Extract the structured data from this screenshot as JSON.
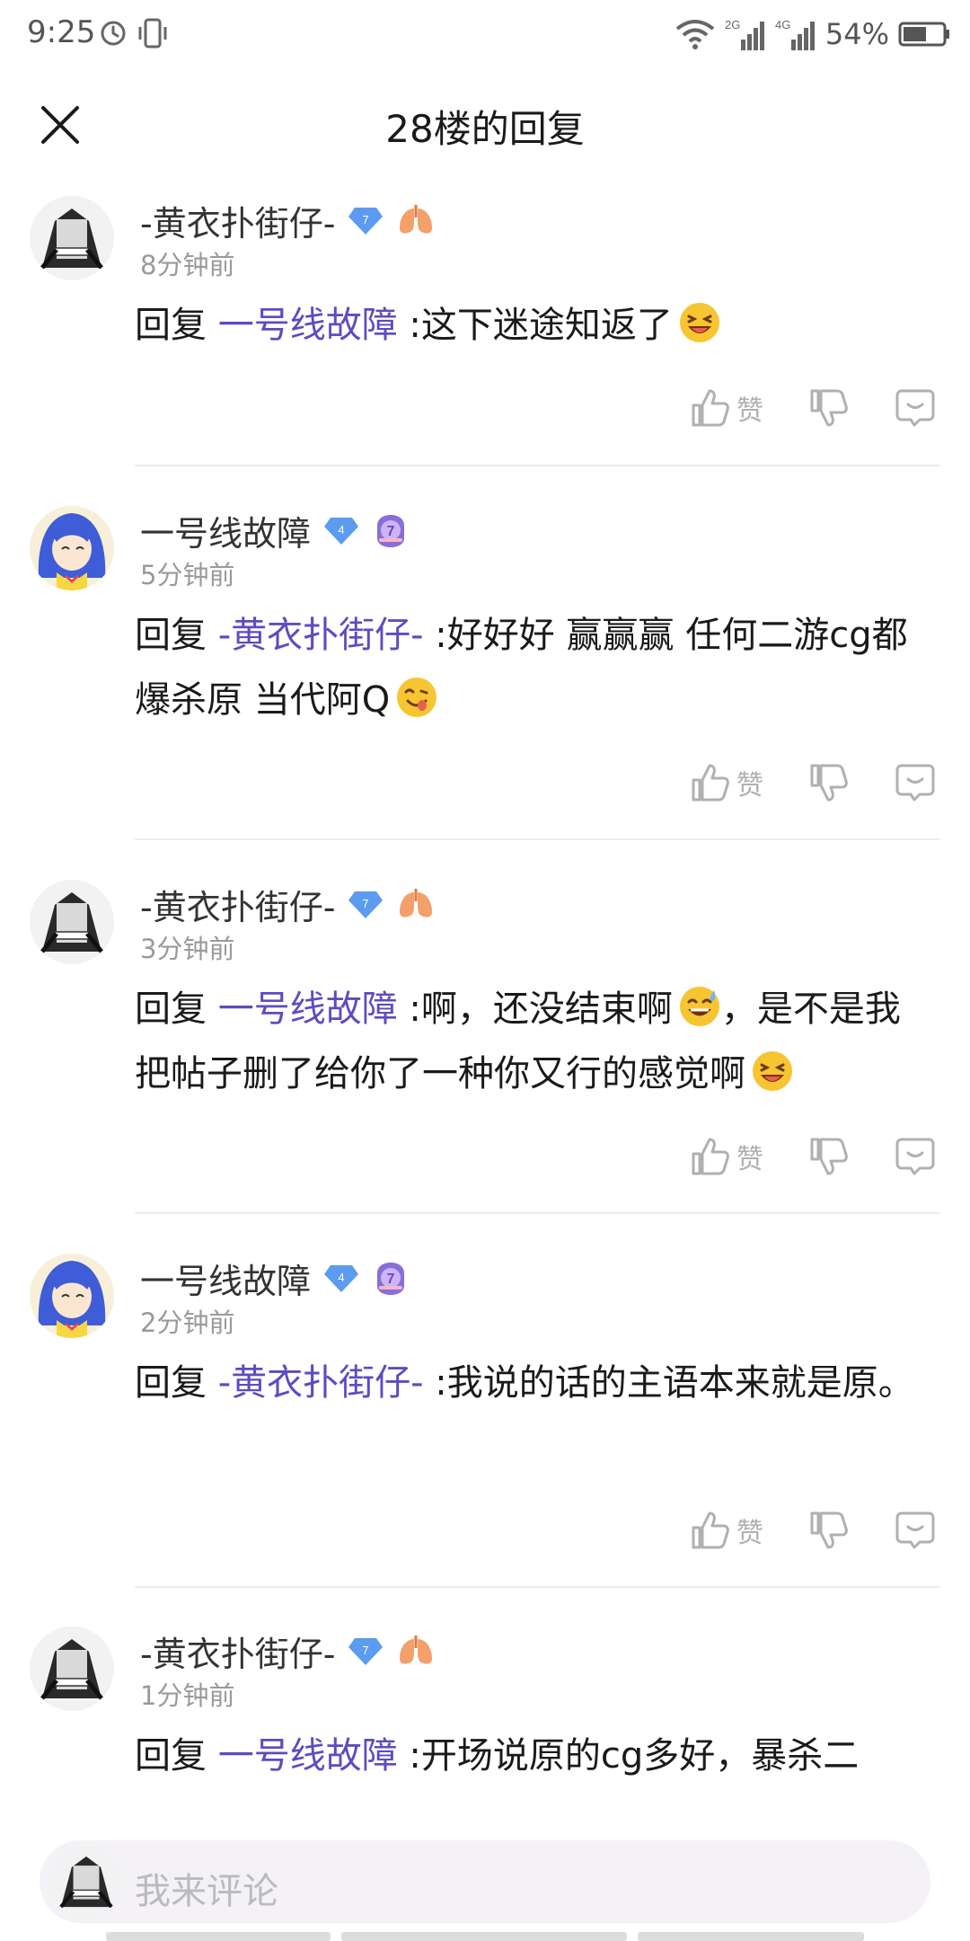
{
  "status": {
    "time": "9:25",
    "net1": "2G",
    "net2": "4G",
    "battery": "54%"
  },
  "header": {
    "title": "28楼的回复"
  },
  "comments": [
    {
      "user": "-黄衣扑街仔-",
      "level": "7",
      "time": "8分钟前",
      "prefix": "回复 ",
      "mention": "一号线故障",
      "text": " :这下迷途知返了",
      "emoji": "laugh-emoji",
      "like_label": "赞"
    },
    {
      "user": "一号线故障",
      "level": "4",
      "time": "5分钟前",
      "prefix": "回复 ",
      "mention": "-黄衣扑街仔-",
      "text": " :好好好 赢赢赢 任何二游cg都爆杀原 当代阿Q",
      "emoji": "yum-emoji",
      "like_label": "赞"
    },
    {
      "user": "-黄衣扑街仔-",
      "level": "7",
      "time": "3分钟前",
      "prefix": "回复 ",
      "mention": "一号线故障",
      "text": " :啊，还没结束啊",
      "text2": "，是不是我把帖子删了给你了一种你又行的感觉啊",
      "emoji": "sweat-emoji",
      "emoji2": "laugh-emoji",
      "like_label": "赞"
    },
    {
      "user": "一号线故障",
      "level": "4",
      "time": "2分钟前",
      "prefix": "回复 ",
      "mention": "-黄衣扑街仔-",
      "text": " :我说的话的主语本来就是原。",
      "like_label": "赞"
    },
    {
      "user": "-黄衣扑街仔-",
      "level": "7",
      "time": "1分钟前",
      "prefix": "回复 ",
      "mention": "一号线故障",
      "text": " :开场说原的cg多好，暴杀二"
    }
  ],
  "composer": {
    "placeholder": "我来评论"
  },
  "colors": {
    "link": "#5f4bc0",
    "badge_blue": "#5b9cf0",
    "badge_purple": "#8a6ed8",
    "lung_orange": "#f3a06a"
  }
}
